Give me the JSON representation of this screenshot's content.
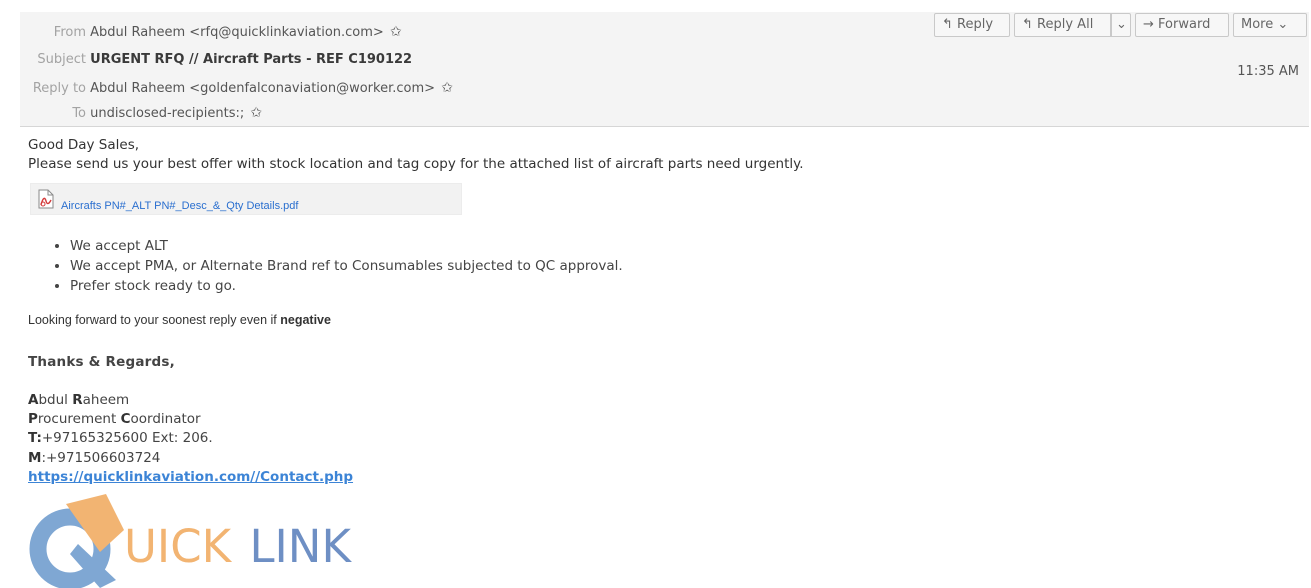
{
  "header": {
    "from_label": "From",
    "from_value": "Abdul Raheem <rfq@quicklinkaviation.com>",
    "subject_label": "Subject",
    "subject_value": "URGENT RFQ // Aircraft Parts - REF C190122",
    "replyto_label": "Reply to",
    "replyto_value": "Abdul Raheem <goldenfalconaviation@worker.com>",
    "to_label": "To",
    "to_value": "undisclosed-recipients:;",
    "time": "11:35 AM",
    "star_glyph": "✩"
  },
  "toolbar": {
    "reply_icon": "↰",
    "reply_label": "Reply",
    "replyall_icon": "↰",
    "replyall_label": "Reply All",
    "dropdown_glyph": "⌄",
    "forward_icon": "→",
    "forward_label": "Forward",
    "more_label": "More",
    "more_arrow": "⌄"
  },
  "message": {
    "greeting": "Good Day Sales,",
    "request": "Please send us your best offer with stock location and tag copy for the attached list of aircraft parts need urgently.",
    "attachment": "Aircrafts PN#_ALT PN#_Desc_&_Qty Details.pdf",
    "bullets": [
      "We accept ALT",
      "We accept PMA, or Alternate Brand ref to Consumables  subjected to QC approval.",
      "Prefer stock ready to go."
    ],
    "closing_prefix": "Looking forward to your soonest reply even if ",
    "closing_bold": "negative",
    "regards": "Thanks & Regards,"
  },
  "signature": {
    "name_initial1": "A",
    "name_rest1": "bdul ",
    "name_initial2": "R",
    "name_rest2": "aheem",
    "title_initial1": "P",
    "title_rest1": "rocurement ",
    "title_initial2": "C",
    "title_rest2": "oordinator",
    "phone_label": "T:",
    "phone_value": "+97165325600 Ext: 206.",
    "mobile_label": "M",
    "mobile_value": ":+971506603724",
    "website": "https://quicklinkaviation.com//Contact.php"
  },
  "logo": {
    "text_uick": "UICK",
    "text_link": "LINK",
    "color_q_blue": "#7fa7d3",
    "color_orange": "#f2b472",
    "color_link": "#6e8fc4"
  }
}
